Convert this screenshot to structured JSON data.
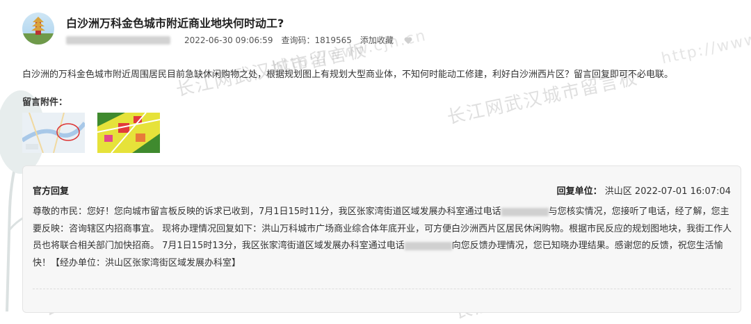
{
  "post": {
    "title": "白沙洲万科金色城市附近商业地块何时动工?",
    "datetime": "2022-06-30 09:06:59",
    "query_code": "查询码：1819565",
    "favorite_label": "添加收藏",
    "body": "白沙洲的万科金色城市附近周围居民目前急缺休闲购物之处，根据规划图上有规划大型商业体，不知何时能动工修建，利好白沙洲西片区？留言回复即可不必电联。",
    "attachments_label": "留言附件："
  },
  "reply": {
    "title": "官方回复",
    "unit_label": "回复单位：",
    "unit_value": "洪山区 2022-07-01 16:07:04",
    "text_part1": "尊敬的市民：您好！您向城市留言板反映的诉求已收到，7月1日15时11分，我区张家湾街道区域发展办科室通过电话",
    "text_part2": "与您核实情况，您接听了电话，经了解，您主要反映：咨询辖区内招商事宜。 现将办理情况回复如下：洪山万科城市广场商业综合体年底开业，可方便白沙洲西片区居民休闲购物。根据市民反应的规划图地块，我街工作人员也将联合相关部门加快招商。 7月1日15时13分，我区张家湾街道区域发展办科室通过电话",
    "text_part3": "向您反馈办理情况，您已知晓办理结果。感谢您的反馈，祝您生活愉快！【经办单位：洪山区张家湾街区域发展办科室】"
  },
  "watermarks": {
    "main": "长江网武汉城市留言板",
    "url1": "http://www.cjn.cn",
    "url2": "http://www"
  },
  "colors": {
    "reply_bg": "#f7f7f7",
    "text": "#333333"
  }
}
